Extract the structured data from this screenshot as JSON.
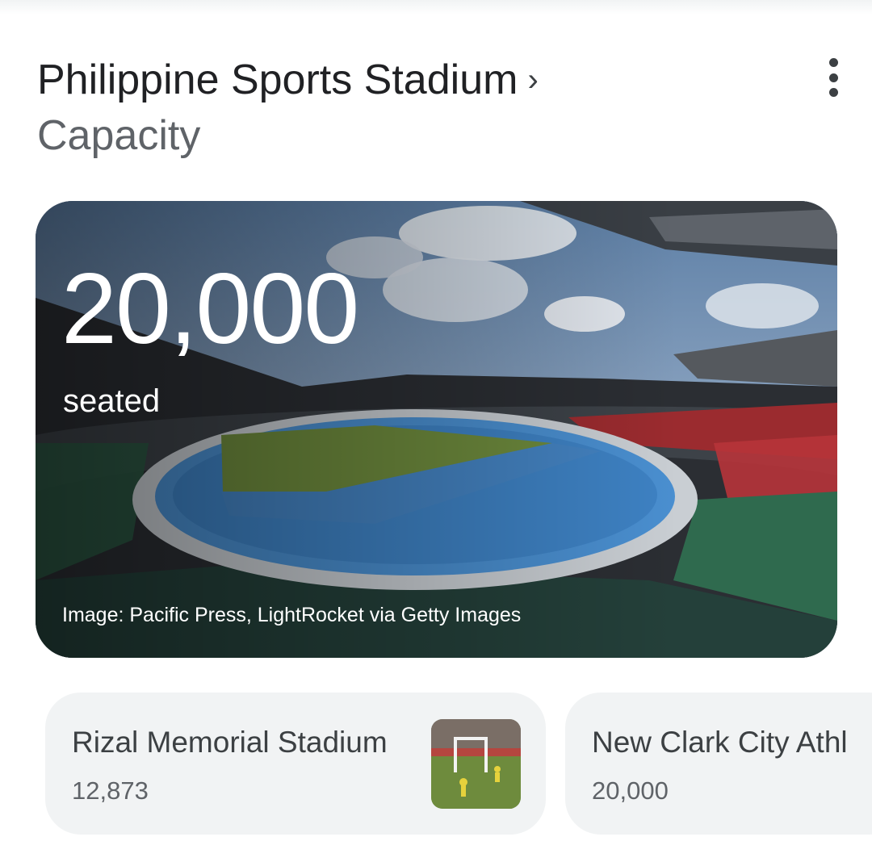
{
  "header": {
    "entity": "Philippine Sports Stadium",
    "chevron": "›",
    "attribute": "Capacity"
  },
  "more_icon": "more-vertical-icon",
  "hero": {
    "value": "20,000",
    "unit": "seated",
    "credit": "Image: Pacific Press, LightRocket via Getty Images"
  },
  "related": [
    {
      "name": "Rizal Memorial Stadium",
      "capacity": "12,873"
    },
    {
      "name": "New Clark City Athl",
      "capacity": "20,000"
    }
  ],
  "colors": {
    "text_primary": "#202124",
    "text_secondary": "#5f6368",
    "chip_bg": "#f1f3f4",
    "track_blue": "#4a8fd0",
    "pitch_green": "#6e8b3d"
  }
}
